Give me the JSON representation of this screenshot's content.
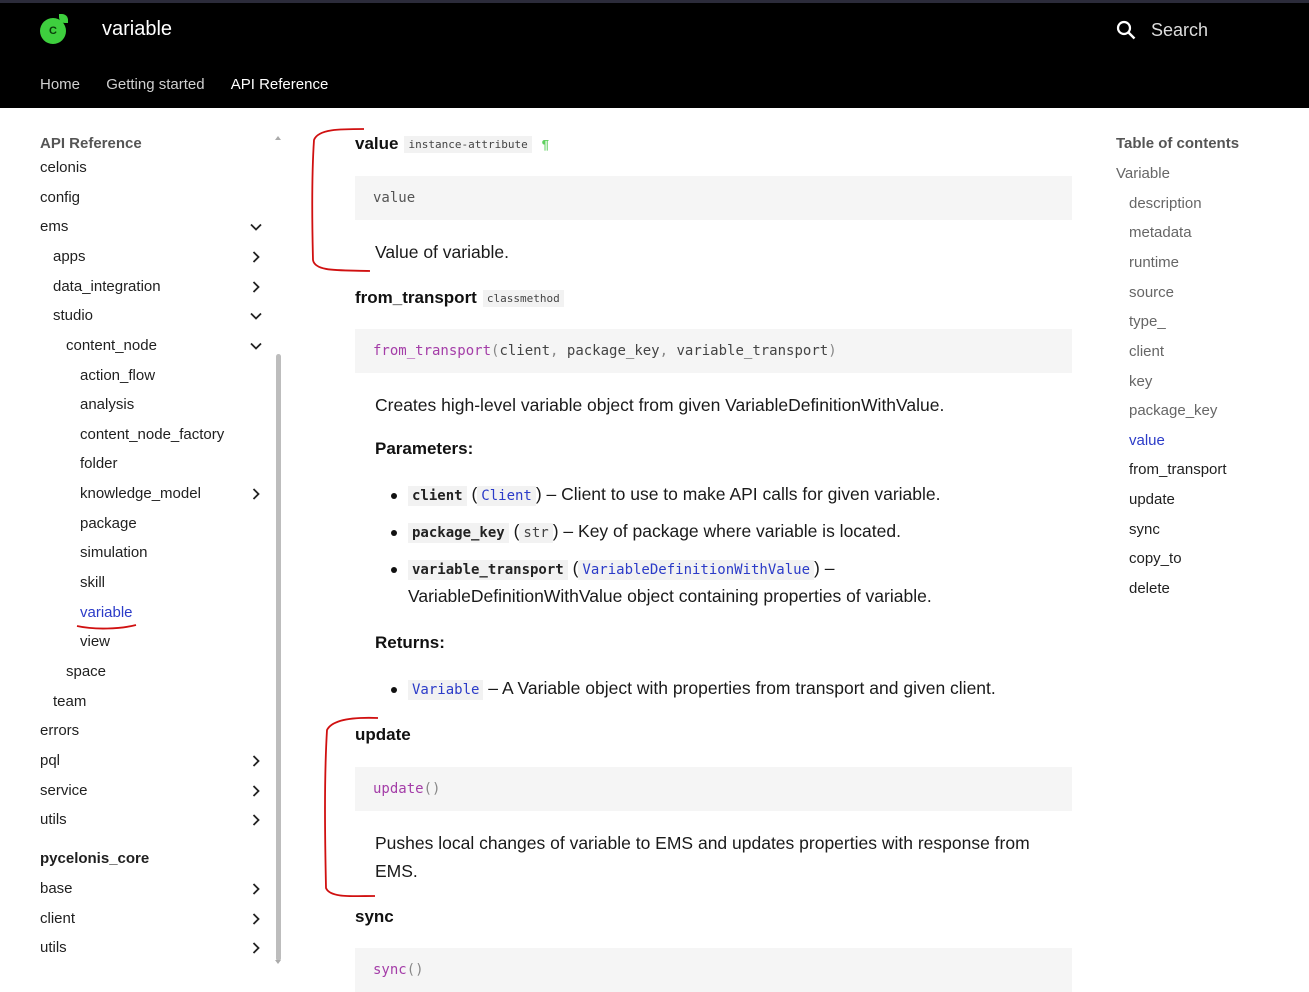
{
  "header": {
    "logo_letter": "C",
    "title": "variable",
    "search_label": "Search",
    "tabs": [
      {
        "label": "Home"
      },
      {
        "label": "Getting started"
      },
      {
        "label": "API Reference"
      }
    ]
  },
  "sidebar": {
    "heading": "API Reference",
    "items": [
      {
        "label": "celonis"
      },
      {
        "label": "config"
      },
      {
        "label": "ems"
      },
      {
        "label": "apps"
      },
      {
        "label": "data_integration"
      },
      {
        "label": "studio"
      },
      {
        "label": "content_node"
      },
      {
        "label": "action_flow"
      },
      {
        "label": "analysis"
      },
      {
        "label": "content_node_factory"
      },
      {
        "label": "folder"
      },
      {
        "label": "knowledge_model"
      },
      {
        "label": "package"
      },
      {
        "label": "simulation"
      },
      {
        "label": "skill"
      },
      {
        "label": "variable"
      },
      {
        "label": "view"
      },
      {
        "label": "space"
      },
      {
        "label": "team"
      },
      {
        "label": "errors"
      },
      {
        "label": "pql"
      },
      {
        "label": "service"
      },
      {
        "label": "utils"
      },
      {
        "label": "pycelonis_core"
      },
      {
        "label": "base"
      },
      {
        "label": "client"
      },
      {
        "label": "utils"
      }
    ]
  },
  "main": {
    "value": {
      "name": "value",
      "badge": "instance-attribute",
      "pilcrow": "¶",
      "code": "value",
      "desc": "Value of variable."
    },
    "from_transport": {
      "name": "from_transport",
      "badge": "classmethod",
      "sig_fn": "from_transport",
      "sig_open": "(",
      "sig_arg1": "client",
      "sig_comma1": ", ",
      "sig_arg2": "package_key",
      "sig_comma2": ", ",
      "sig_arg3": "variable_transport",
      "sig_close": ")",
      "desc": "Creates high-level variable object from given VariableDefinitionWithValue.",
      "params_label": "Parameters:",
      "params": [
        {
          "name": "client",
          "type": "Client",
          "desc": "Client to use to make API calls for given variable."
        },
        {
          "name": "package_key",
          "type": "str",
          "desc": "Key of package where variable is located."
        },
        {
          "name": "variable_transport",
          "type": "VariableDefinitionWithValue",
          "desc": "",
          "desc_cont": "VariableDefinitionWithValue object containing properties of variable."
        }
      ],
      "returns_label": "Returns:",
      "returns_type": "Variable",
      "returns_desc": "A Variable object with properties from transport and given client."
    },
    "update": {
      "name": "update",
      "sig_fn": "update",
      "sig_parens": "()",
      "desc_line1": "Pushes local changes of variable to EMS and updates properties with response from",
      "desc_line2": "EMS."
    },
    "sync": {
      "name": "sync",
      "sig_fn": "sync",
      "sig_parens": "()"
    }
  },
  "toc": {
    "title": "Table of contents",
    "items": [
      {
        "label": "Variable"
      },
      {
        "label": "description"
      },
      {
        "label": "metadata"
      },
      {
        "label": "runtime"
      },
      {
        "label": "source"
      },
      {
        "label": "type_"
      },
      {
        "label": "client"
      },
      {
        "label": "key"
      },
      {
        "label": "package_key"
      },
      {
        "label": "value"
      },
      {
        "label": "from_transport"
      },
      {
        "label": "update"
      },
      {
        "label": "sync"
      },
      {
        "label": "copy_to"
      },
      {
        "label": "delete"
      }
    ]
  },
  "colors": {
    "header_bg": "#000000",
    "link_blue": "#2b3bc8",
    "logo_green": "#3ecf3e",
    "code_fn_purple": "#a43da8",
    "annotation_red": "#d01010"
  }
}
